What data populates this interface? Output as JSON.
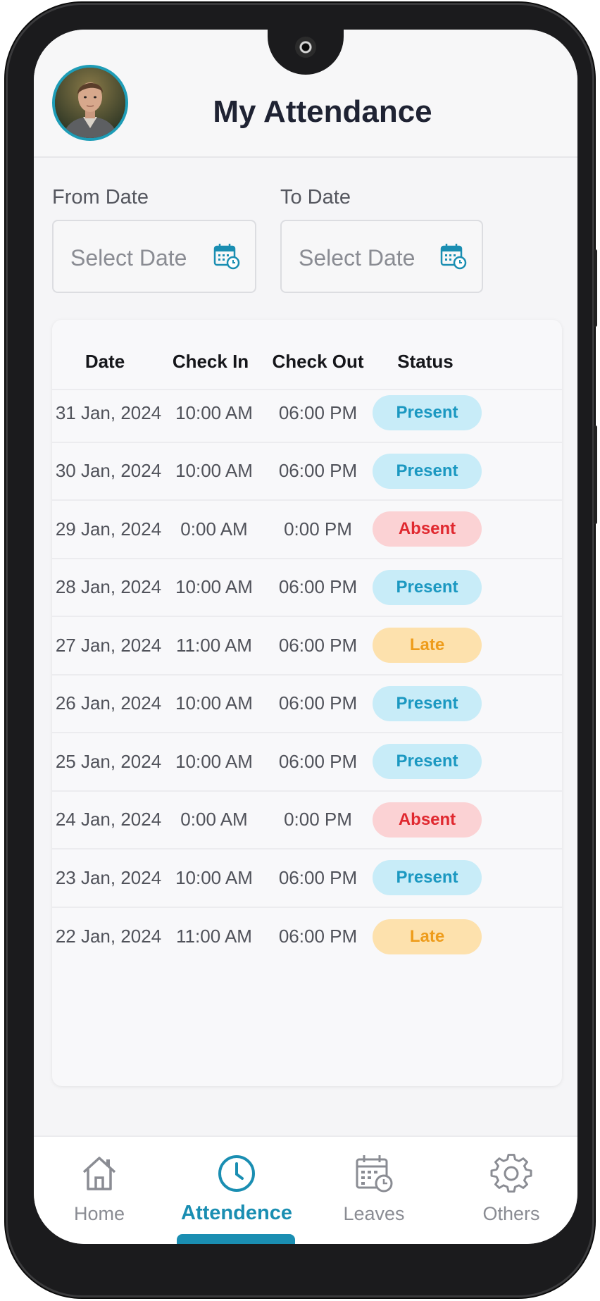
{
  "header": {
    "title": "My Attendance"
  },
  "filters": {
    "from_label": "From Date",
    "from_placeholder": "Select Date",
    "to_label": "To Date",
    "to_placeholder": "Select Date"
  },
  "table": {
    "columns": [
      "Date",
      "Check In",
      "Check Out",
      "Status"
    ],
    "rows": [
      {
        "date": "31 Jan, 2024",
        "check_in": "10:00 AM",
        "check_out": "06:00 PM",
        "status": "Present"
      },
      {
        "date": "30 Jan, 2024",
        "check_in": "10:00 AM",
        "check_out": "06:00 PM",
        "status": "Present"
      },
      {
        "date": "29 Jan, 2024",
        "check_in": "0:00 AM",
        "check_out": "0:00 PM",
        "status": "Absent"
      },
      {
        "date": "28 Jan, 2024",
        "check_in": "10:00 AM",
        "check_out": "06:00 PM",
        "status": "Present"
      },
      {
        "date": "27 Jan, 2024",
        "check_in": "11:00 AM",
        "check_out": "06:00 PM",
        "status": "Late"
      },
      {
        "date": "26 Jan, 2024",
        "check_in": "10:00 AM",
        "check_out": "06:00 PM",
        "status": "Present"
      },
      {
        "date": "25 Jan, 2024",
        "check_in": "10:00 AM",
        "check_out": "06:00 PM",
        "status": "Present"
      },
      {
        "date": "24 Jan, 2024",
        "check_in": "0:00 AM",
        "check_out": "0:00 PM",
        "status": "Absent"
      },
      {
        "date": "23 Jan, 2024",
        "check_in": "10:00 AM",
        "check_out": "06:00 PM",
        "status": "Present"
      },
      {
        "date": "22 Jan, 2024",
        "check_in": "11:00 AM",
        "check_out": "06:00 PM",
        "status": "Late"
      }
    ]
  },
  "nav": {
    "items": [
      {
        "label": "Home",
        "icon": "home-icon"
      },
      {
        "label": "Attendence",
        "icon": "clock-icon",
        "active": true
      },
      {
        "label": "Leaves",
        "icon": "calendar-icon"
      },
      {
        "label": "Others",
        "icon": "gear-icon"
      }
    ]
  },
  "colors": {
    "accent": "#1a8eb2",
    "present_bg": "#c8ecf8",
    "absent_bg": "#fbd2d4",
    "late_bg": "#fde1ad"
  }
}
